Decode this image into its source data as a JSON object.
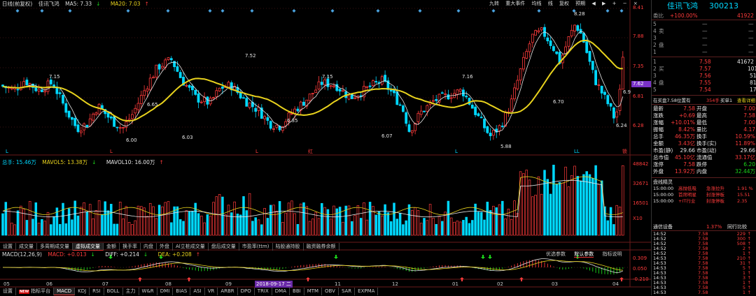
{
  "header": {
    "period": "日线(前复权)",
    "stock_name": "佳讯飞鸿",
    "ma5_label": "MA5: 7.33",
    "ma5_arrow": "↓",
    "ma20_label": "MA20: 7.03",
    "ma20_arrow": "↑",
    "toolbar": [
      "九转",
      "重大事件",
      "均线",
      "线",
      "复权",
      "预期",
      "◀",
      "▶",
      "+",
      "−",
      "×"
    ]
  },
  "price_axis": [
    "8.41",
    "7.88",
    "7.35",
    "6.81",
    "6.28"
  ],
  "current_price_tag": "7.62",
  "price_annotations": [
    "7.15",
    "6.65",
    "6.00",
    "6.03",
    "7.52",
    "6.35",
    "7.15",
    "6.07",
    "7.16",
    "6.70",
    "5.88",
    "8.28",
    "6.24",
    "6.9"
  ],
  "volume_header": {
    "total": "总手: 15.46万",
    "mavol5": "MAVOL5: 13.38万",
    "mavol5_arrow": "↓",
    "mavol10": "MAVOL10: 16.00万",
    "mavol10_arrow": "↑"
  },
  "volume_axis": [
    "48842",
    "32671",
    "16501",
    "X10"
  ],
  "indicator_tabs": [
    "设置",
    "成交量",
    "多周期成交量",
    "虚拟成交量",
    "金额",
    "换手率",
    "内盘",
    "外盘",
    "Al立桩成交量",
    "盘后成交量",
    "市盈率(ttm)",
    "陆股通持股",
    "融资融券余额"
  ],
  "indicator_active": "虚拟成交量",
  "macd_header": {
    "title": "MACD(12,26,9)",
    "macd": "MACD: +0.013",
    "diff": "DIFF: +0.214",
    "dea": "DEA: +0.208",
    "macd_arrow": "↓",
    "diff_arrow": "↓",
    "dea_arrow": "↑"
  },
  "macd_buttons": [
    "优选参数",
    "默认参数",
    "指标说明"
  ],
  "macd_axis": [
    "0.309",
    "0.050",
    "-0.210"
  ],
  "month_labels": [
    "05",
    "06",
    "07",
    "08",
    "09",
    "2018-09-17 二",
    "11",
    "12",
    "01",
    "02",
    "03",
    "04"
  ],
  "bottom_tabs": [
    "设置",
    "指标平台",
    "MACD",
    "KDJ",
    "RSI",
    "BOLL",
    "主力",
    "W&R",
    "DMI",
    "BIAS",
    "ASI",
    "VR",
    "ARBR",
    "DPO",
    "TRIX",
    "DMA",
    "BBI",
    "MTM",
    "OBV",
    "SAR",
    "EXPMA"
  ],
  "bottom_active": "MACD",
  "bottom_new_badge": "NEW",
  "panel": {
    "title": "佳讯飞鸿",
    "code": "300213",
    "weibi_label": "委比",
    "weibi_value": "+100.00%",
    "weicha_value": "41922",
    "sell_label": "卖",
    "sell_side_chars": [
      "卖",
      "盘"
    ],
    "sell_levels": [
      "5",
      "4",
      "3",
      "2",
      "1"
    ],
    "sell_empty": "—",
    "buy_label": "买",
    "buy_side_chars": [
      "买",
      "盘"
    ],
    "buy_levels": [
      {
        "lvl": "1",
        "price": "7.58",
        "vol": "41672"
      },
      {
        "lvl": "2",
        "price": "7.57",
        "vol": "101"
      },
      {
        "lvl": "3",
        "price": "7.56",
        "vol": "51"
      },
      {
        "lvl": "4",
        "price": "7.55",
        "vol": "81"
      },
      {
        "lvl": "5",
        "price": "7.54",
        "vol": "17"
      }
    ],
    "notice": "在买盘7.58位置有",
    "notice_mid": "354手",
    "notice_buy": "买单1",
    "notice_link": "查看详细",
    "stats": [
      {
        "l1": "最新",
        "v1": "7.58",
        "l2": "开盘",
        "v2": "7.00"
      },
      {
        "l1": "涨跌",
        "v1": "+0.69",
        "l2": "最高",
        "v2": "7.58"
      },
      {
        "l1": "涨幅",
        "v1": "+10.01%",
        "l2": "最低",
        "v2": "7.00"
      },
      {
        "l1": "振幅",
        "v1": "8.42%",
        "l2": "量比",
        "v2": "4.17"
      },
      {
        "l1": "总手",
        "v1": "46.35万",
        "l2": "换手",
        "v2": "10.59%"
      },
      {
        "l1": "金额",
        "v1": "3.43亿",
        "l2": "换手(实)",
        "v2": "11.89%"
      },
      {
        "l1": "市盈(静)",
        "v1": "29.66",
        "l2": "市盈(动)",
        "v2": "29.66"
      },
      {
        "l1": "总市值",
        "v1": "45.10亿",
        "l2": "流通值",
        "v2": "33.17亿"
      },
      {
        "l1": "涨停",
        "v1": "7.58",
        "l2": "跌停",
        "v2": "6.20"
      },
      {
        "l1": "外盘",
        "v1": "13.92万",
        "l2": "内盘",
        "v2": "32.44万"
      }
    ],
    "events_title": "盘线精灵",
    "events": [
      {
        "time": "15:00:00",
        "name": "高抛低吸",
        "desc": "急涨拉升",
        "val": "1.91 %"
      },
      {
        "time": "15:00:00",
        "name": "首席明星",
        "desc": "封涨停板",
        "val": "15.51"
      },
      {
        "time": "15:00:00",
        "name": "+IT行业",
        "desc": "封涨停板",
        "val": "2.35"
      }
    ],
    "sector_name": "通信设备",
    "sector_pct": "1.37%",
    "sector_link": "同行比较",
    "ticks": [
      {
        "t": "14:52",
        "p": "7.58",
        "v": "229",
        "d": "up"
      },
      {
        "t": "14:52",
        "p": "7.58",
        "v": "300",
        "d": "up"
      },
      {
        "t": "14:52",
        "p": "7.58",
        "v": "508",
        "d": "up"
      },
      {
        "t": "14:52",
        "p": "7.58",
        "v": "2",
        "d": "up"
      },
      {
        "t": "14:52",
        "p": "7.58",
        "v": "1",
        "d": "up"
      },
      {
        "t": "14:53",
        "p": "7.58",
        "v": "210",
        "d": "up"
      },
      {
        "t": "14:53",
        "p": "7.58",
        "v": "31",
        "d": "up"
      },
      {
        "t": "14:53",
        "p": "7.58",
        "v": "5",
        "d": "up"
      },
      {
        "t": "14:53",
        "p": "7.58",
        "v": "1",
        "d": "up"
      },
      {
        "t": "14:53",
        "p": "7.58",
        "v": "3",
        "d": "up"
      },
      {
        "t": "14:53",
        "p": "7.58",
        "v": "1",
        "d": "up"
      },
      {
        "t": "14:53",
        "p": "7.58",
        "v": "5",
        "d": "up"
      },
      {
        "t": "14:53",
        "p": "7.58",
        "v": "1",
        "d": "up"
      }
    ]
  }
}
